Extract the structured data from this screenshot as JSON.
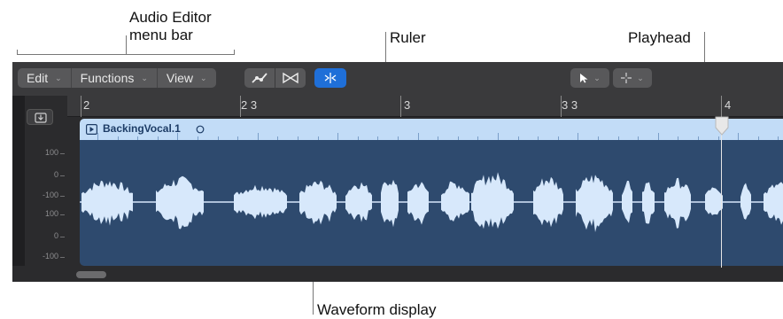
{
  "callouts": {
    "audio_editor_line1": "Audio Editor",
    "audio_editor_line2": "menu bar",
    "ruler": "Ruler",
    "playhead": "Playhead",
    "waveform": "Waveform display"
  },
  "menu": {
    "edit": "Edit",
    "functions": "Functions",
    "view": "View"
  },
  "ruler": {
    "labels": [
      "2",
      "2 3",
      "3",
      "3 3",
      "4"
    ]
  },
  "region": {
    "name": "BackingVocal.1"
  },
  "scale": {
    "labels": [
      "100",
      "0",
      "-100",
      "100",
      "0",
      "-100"
    ]
  },
  "colors": {
    "toolbar": "#3a3a3c",
    "region_header": "#c2dcf7",
    "region_body": "#2e4a6e",
    "waveform": "#d7e8fb",
    "accent_blue": "#1f6fd8"
  },
  "icons": {
    "automation": "automation-curve-icon",
    "flex": "flex-bowtie-icon",
    "catch": "catch-playhead-icon",
    "pointer_tool": "pointer-tool-icon",
    "crosshair_tool": "crosshair-tool-icon",
    "region_play": "play-icon",
    "region_loop": "loop-circle-icon"
  }
}
